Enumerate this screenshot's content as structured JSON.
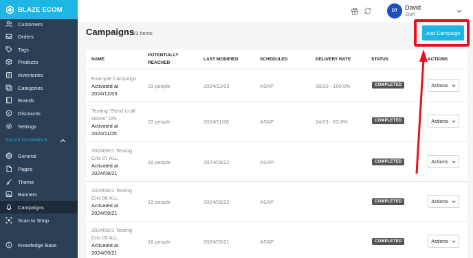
{
  "brand": {
    "name": "BLAZE ECOM"
  },
  "sidebar": {
    "items": [
      {
        "label": "Customers",
        "icon": "users-icon"
      },
      {
        "label": "Orders",
        "icon": "inbox-icon"
      },
      {
        "label": "Tags",
        "icon": "tag-icon"
      },
      {
        "label": "Products",
        "icon": "box-icon"
      },
      {
        "label": "Inventories",
        "icon": "clipboard-icon"
      },
      {
        "label": "Categories",
        "icon": "layers-icon"
      },
      {
        "label": "Brands",
        "icon": "book-icon"
      },
      {
        "label": "Discounts",
        "icon": "percent-icon"
      },
      {
        "label": "Settings",
        "icon": "gear-icon"
      }
    ],
    "section_label": "SALES CHANNELS",
    "channel_items": [
      {
        "label": "General",
        "icon": "globe-icon"
      },
      {
        "label": "Pages",
        "icon": "file-icon"
      },
      {
        "label": "Theme",
        "icon": "brush-icon"
      },
      {
        "label": "Banners",
        "icon": "image-icon"
      },
      {
        "label": "Campaigns",
        "icon": "bell-icon",
        "active": true
      },
      {
        "label": "Scan to Shop",
        "icon": "qr-icon"
      }
    ],
    "footer_item": {
      "label": "Knowledge Base",
      "icon": "info-icon"
    }
  },
  "topbar": {
    "avatar_initials": "DT",
    "user_name": "David",
    "user_role": "Staff"
  },
  "page": {
    "title": "Campaigns",
    "count": "23 Items",
    "add_button": "Add Campaign"
  },
  "table": {
    "headers": {
      "name": "NAME",
      "reached_line1": "POTENTIALLY",
      "reached_line2": "REACHED",
      "modified": "LAST MODIFIED",
      "scheduled": "SCHEDULED",
      "delivery": "DELIVERY RATE",
      "status": "STATUS",
      "actions": "ACTIONS"
    },
    "rows": [
      {
        "name_lines": [
          "Example Campaign"
        ],
        "activated": "Activated at",
        "date": "2024/12/03",
        "reached": "23 people",
        "modified": "2024/12/03",
        "scheduled": "ASAP",
        "delivery": "30/30 - 100.0%",
        "status": "COMPLETED",
        "action": "Actions"
      },
      {
        "name_lines": [
          "Testing \"Send to all",
          "stores\" ON"
        ],
        "activated": "Activated at",
        "date": "2024/11/25",
        "reached": "22 people",
        "modified": "2024/11/26",
        "scheduled": "ASAP",
        "delivery": "24/29 - 82.8%",
        "status": "COMPLETED",
        "action": "Actions"
      },
      {
        "name_lines": [
          "20240921 Testing",
          "Cris 07 ALL"
        ],
        "activated": "Activated at",
        "date": "2024/09/21",
        "reached": "18 people",
        "modified": "2024/09/22",
        "scheduled": "ASAP",
        "delivery": "",
        "status": "COMPLETED",
        "action": "Actions"
      },
      {
        "name_lines": [
          "20240921 Testing",
          "Cris 06 ALL"
        ],
        "activated": "Activated at",
        "date": "2024/09/21",
        "reached": "19 people",
        "modified": "2024/09/22",
        "scheduled": "ASAP",
        "delivery": "",
        "status": "COMPLETED",
        "action": "Actions"
      },
      {
        "name_lines": [
          "20240921 Testing",
          "Cris 05 ALL"
        ],
        "activated": "Activated at",
        "date": "2024/09/21",
        "reached": "18 people",
        "modified": "2024/09/21",
        "scheduled": "ASAP",
        "delivery": "",
        "status": "COMPLETED",
        "action": "Actions"
      }
    ]
  },
  "colors": {
    "accent": "#1fb5e5",
    "sidebar": "#2a3f54",
    "highlight": "#e8101c",
    "badge": "#555555"
  }
}
